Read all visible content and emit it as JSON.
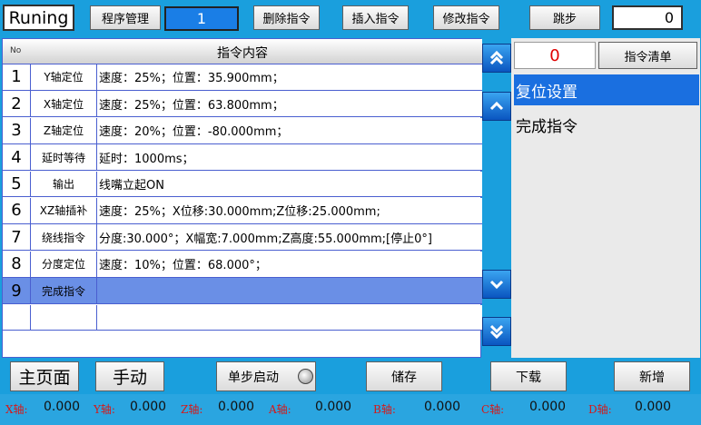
{
  "top": {
    "status": "Runing",
    "program_btn": "程序管理",
    "program_no": "1",
    "delete_btn": "删除指令",
    "insert_btn": "插入指令",
    "modify_btn": "修改指令",
    "jump_btn": "跳步",
    "jump_no": "0"
  },
  "table": {
    "col_no": "No",
    "col_title": "指令内容",
    "rows": [
      {
        "no": "1",
        "name": "Y轴定位",
        "content": "速度：25%；位置：35.900mm；"
      },
      {
        "no": "2",
        "name": "X轴定位",
        "content": "速度：25%；位置：63.800mm；"
      },
      {
        "no": "3",
        "name": "Z轴定位",
        "content": "速度：20%；位置：-80.000mm；"
      },
      {
        "no": "4",
        "name": "延时等待",
        "content": "延时：1000ms；"
      },
      {
        "no": "5",
        "name": "输出",
        "content": "线嘴立起ON"
      },
      {
        "no": "6",
        "name": "XZ轴插补",
        "content": "速度：25%；X位移:30.000mm;Z位移:25.000mm;"
      },
      {
        "no": "7",
        "name": "绕线指令",
        "content": "分度:30.000°；X幅宽:7.000mm;Z高度:55.000mm;[停止0°]"
      },
      {
        "no": "8",
        "name": "分度定位",
        "content": "速度：10%；位置：68.000°；"
      },
      {
        "no": "9",
        "name": "完成指令",
        "content": ""
      },
      {
        "no": "",
        "name": "",
        "content": ""
      }
    ]
  },
  "side": {
    "count": "0",
    "clear_btn": "指令清单",
    "items": [
      "复位设置",
      "完成指令"
    ]
  },
  "bottom": {
    "home_btn": "主页面",
    "manual_btn": "手动",
    "step_btn": "单步启动",
    "save_btn": "储存",
    "download_btn": "下载",
    "add_btn": "新增"
  },
  "axes": [
    {
      "label": "X轴:",
      "value": "0.000"
    },
    {
      "label": "Y轴:",
      "value": "0.000"
    },
    {
      "label": "Z轴:",
      "value": "0.000"
    },
    {
      "label": "A轴:",
      "value": "0.000"
    },
    {
      "label": "B轴:",
      "value": "0.000"
    },
    {
      "label": "C轴:",
      "value": "0.000"
    },
    {
      "label": "D轴:",
      "value": "0.000"
    }
  ],
  "colors": {
    "background": "#1a9fdd",
    "selected_row": "#6a8fe6",
    "side_selected": "#1a6fe0",
    "axis_label": "#d61818",
    "count": "#e00000"
  }
}
